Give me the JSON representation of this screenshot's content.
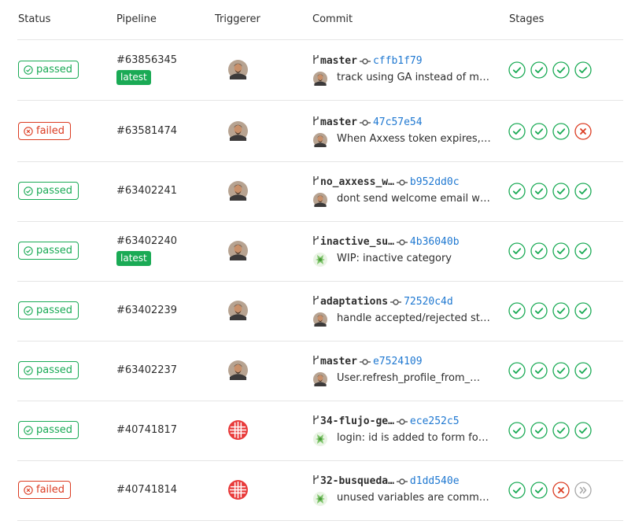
{
  "header": {
    "status": "Status",
    "pipeline": "Pipeline",
    "triggerer": "Triggerer",
    "commit": "Commit",
    "stages": "Stages"
  },
  "colors": {
    "success": "#1aaa55",
    "failed": "#db3b21",
    "skipped": "#a7a7a7",
    "link": "#1f78d1"
  },
  "pipelines": [
    {
      "status": "passed",
      "status_type": "success",
      "id": "#63856345",
      "tag": "latest",
      "triggerer_avatar": "person-photo",
      "branch": "master",
      "sha": "cffb1f79",
      "commit_avatar": "person-photo",
      "message": "track using GA instead of m…",
      "stages": [
        "success",
        "success",
        "success",
        "success"
      ]
    },
    {
      "status": "failed",
      "status_type": "failed",
      "id": "#63581474",
      "tag": "",
      "triggerer_avatar": "person-photo",
      "branch": "master",
      "sha": "47c57e54",
      "commit_avatar": "person-photo",
      "message": "When Axxess token expires,…",
      "stages": [
        "success",
        "success",
        "success",
        "failed"
      ]
    },
    {
      "status": "passed",
      "status_type": "success",
      "id": "#63402241",
      "tag": "",
      "triggerer_avatar": "person-photo",
      "branch": "no_axxess_w…",
      "sha": "b952dd0c",
      "commit_avatar": "person-photo",
      "message": "dont send welcome email w…",
      "stages": [
        "success",
        "success",
        "success",
        "success"
      ]
    },
    {
      "status": "passed",
      "status_type": "success",
      "id": "#63402240",
      "tag": "latest",
      "triggerer_avatar": "person-photo",
      "branch": "inactive_su…",
      "sha": "4b36040b",
      "commit_avatar": "green-identicon",
      "message": "WIP: inactive category",
      "stages": [
        "success",
        "success",
        "success",
        "success"
      ]
    },
    {
      "status": "passed",
      "status_type": "success",
      "id": "#63402239",
      "tag": "",
      "triggerer_avatar": "person-photo",
      "branch": "adaptations",
      "sha": "72520c4d",
      "commit_avatar": "person-photo",
      "message": "handle accepted/rejected st…",
      "stages": [
        "success",
        "success",
        "success",
        "success"
      ]
    },
    {
      "status": "passed",
      "status_type": "success",
      "id": "#63402237",
      "tag": "",
      "triggerer_avatar": "person-photo",
      "branch": "master",
      "sha": "e7524109",
      "commit_avatar": "person-photo",
      "message": "User.refresh_profile_from_…",
      "stages": [
        "success",
        "success",
        "success",
        "success"
      ]
    },
    {
      "status": "passed",
      "status_type": "success",
      "id": "#40741817",
      "tag": "",
      "triggerer_avatar": "red-identicon",
      "branch": "34-flujo-ge…",
      "sha": "ece252c5",
      "commit_avatar": "green-identicon",
      "message": "login: id is added to form fo…",
      "stages": [
        "success",
        "success",
        "success",
        "success"
      ]
    },
    {
      "status": "failed",
      "status_type": "failed",
      "id": "#40741814",
      "tag": "",
      "triggerer_avatar": "red-identicon",
      "branch": "32-busqueda…",
      "sha": "d1dd540e",
      "commit_avatar": "green-identicon",
      "message": "unused variables are comm…",
      "stages": [
        "success",
        "success",
        "failed",
        "skipped"
      ]
    }
  ]
}
